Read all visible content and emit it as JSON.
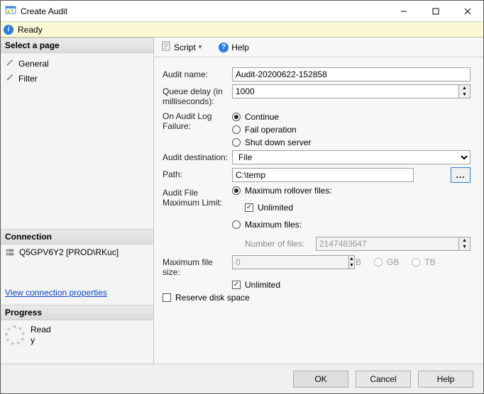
{
  "window": {
    "title": "Create Audit"
  },
  "status_bar": {
    "ready": "Ready"
  },
  "left": {
    "select_page": "Select a page",
    "pages": [
      {
        "label": "General"
      },
      {
        "label": "Filter"
      }
    ],
    "connection_header": "Connection",
    "connection_text": "Q5GPV6Y2 [PROD\\RKuc]",
    "view_conn_link": "View connection properties",
    "progress_header": "Progress",
    "progress_text": "Ready"
  },
  "toolbar": {
    "script": "Script",
    "help": "Help"
  },
  "form": {
    "audit_name_label": "Audit name:",
    "audit_name_value": "Audit-20200622-152858",
    "queue_delay_label": "Queue delay (in milliseconds):",
    "queue_delay_value": "1000",
    "on_failure_label": "On Audit Log Failure:",
    "on_failure_options": {
      "continue": "Continue",
      "fail": "Fail operation",
      "shutdown": "Shut down server"
    },
    "audit_dest_label": "Audit destination:",
    "audit_dest_value": "File",
    "path_label": "Path:",
    "path_value": "C:\\temp",
    "browse_btn": "...",
    "max_limit_label": "Audit File Maximum Limit:",
    "max_limit_options": {
      "rollover": "Maximum rollover files:",
      "files": "Maximum files:"
    },
    "unlimited_label": "Unlimited",
    "num_files_label": "Number of files:",
    "num_files_value": "2147483647",
    "max_size_label": "Maximum file size:",
    "max_size_value": "0",
    "units": {
      "mb": "MB",
      "gb": "GB",
      "tb": "TB"
    },
    "reserve_label": "Reserve disk space"
  },
  "footer": {
    "ok": "OK",
    "cancel": "Cancel",
    "help": "Help"
  }
}
